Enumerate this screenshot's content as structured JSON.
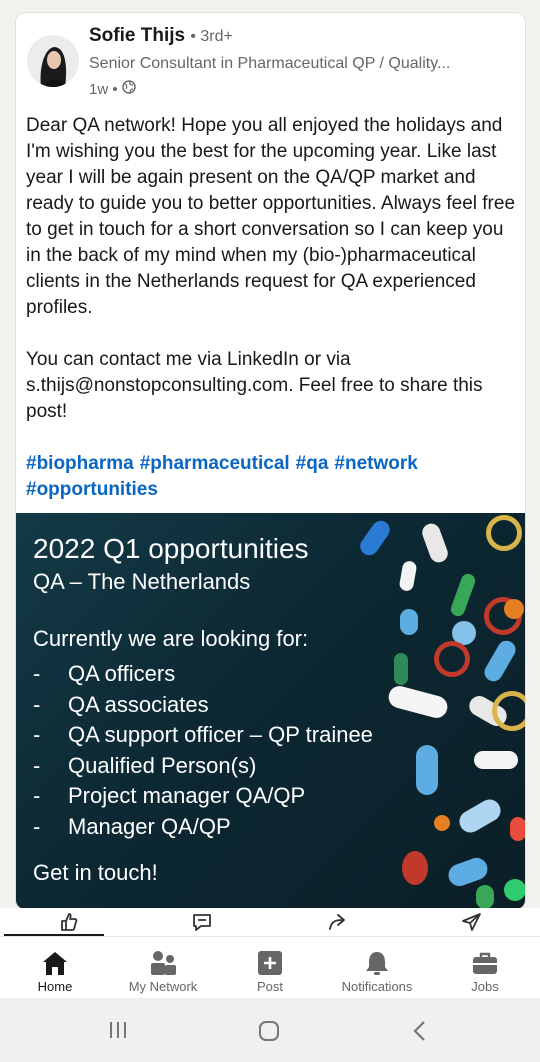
{
  "post": {
    "author": {
      "name": "Sofie Thijs",
      "degree": "• 3rd+",
      "headline": "Senior Consultant in Pharmaceutical QP / Quality...",
      "time": "1w •"
    },
    "body": "Dear QA network! Hope you all enjoyed the holidays and I'm wishing you the best for the upcoming year. Like last year I will be again present on the QA/QP market and ready to guide you to better opportunities. Always feel free to get in touch for a short conversation so I can keep you in the back of my mind when my (bio-)pharmaceutical clients in the Netherlands request for QA experienced profiles.\n\nYou can contact me via LinkedIn or via s.thijs@nonstopconsulting.com. Feel free to share this post!",
    "hashtags": [
      "#biopharma",
      "#pharmaceutical",
      "#qa",
      "#network",
      "#opportunities"
    ]
  },
  "banner": {
    "title": "2022 Q1 opportunities",
    "subtitle": "QA – The Netherlands",
    "intro": "Currently we are looking for:",
    "roles": [
      "QA officers",
      "QA associates",
      "QA support officer – QP trainee",
      "Qualified Person(s)",
      "Project manager QA/QP",
      "Manager QA/QP"
    ],
    "bullet": "-",
    "cta": "Get in touch!"
  },
  "nav": {
    "home": "Home",
    "network": "My Network",
    "post": "Post",
    "notifications": "Notifications",
    "jobs": "Jobs"
  },
  "icons": {
    "visibility": "globe-icon",
    "like": "thumbs-up-icon",
    "comment": "comment-icon",
    "share": "share-arrow-icon",
    "send": "send-icon"
  },
  "colors": {
    "link": "#0a66c2",
    "banner_bg": "#0c2833"
  }
}
